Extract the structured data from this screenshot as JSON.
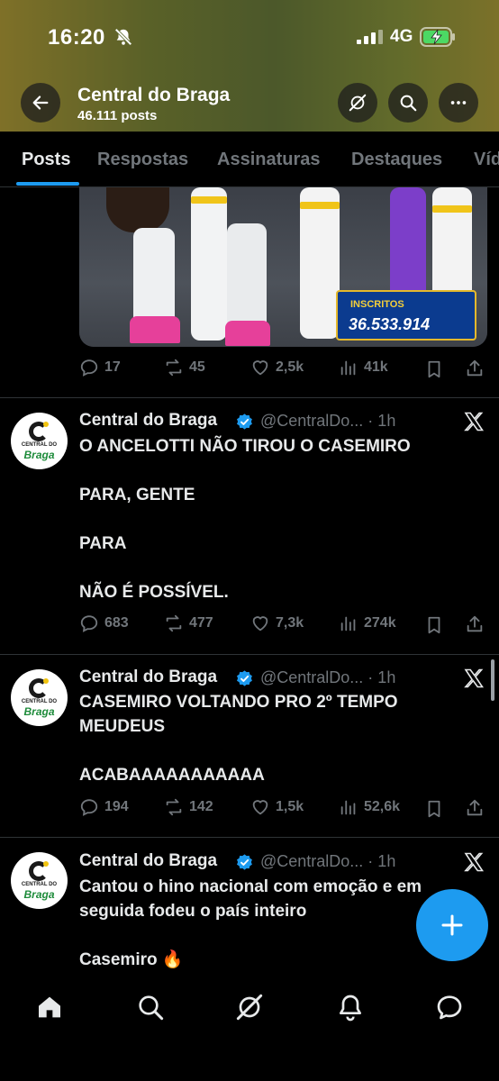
{
  "status_bar": {
    "time": "16:20",
    "network": "4G"
  },
  "profile": {
    "name": "Central do Braga",
    "post_count": "46.111 posts"
  },
  "tabs": [
    {
      "label": "Posts",
      "active": true
    },
    {
      "label": "Respostas"
    },
    {
      "label": "Assinaturas"
    },
    {
      "label": "Destaques"
    },
    {
      "label": "Víd"
    }
  ],
  "media_overlay": {
    "label": "INSCRITOS",
    "value": "36.533.914"
  },
  "avatar_text": {
    "small": "CENTRAL DO",
    "brand": "Braga"
  },
  "first_post_stats": {
    "replies": "17",
    "reposts": "45",
    "likes": "2,5k",
    "views": "41k"
  },
  "posts": [
    {
      "name": "Central do Braga",
      "handle_time": "@CentralDo... · 1h",
      "lines": [
        "O ANCELOTTI NÃO TIROU O CASEMIRO",
        "",
        "PARA, GENTE",
        "",
        "PARA",
        "",
        "NÃO É POSSÍVEL."
      ],
      "replies": "683",
      "reposts": "477",
      "likes": "7,3k",
      "views": "274k"
    },
    {
      "name": "Central do Braga",
      "handle_time": "@CentralDo... · 1h",
      "lines": [
        "CASEMIRO VOLTANDO PRO 2º TEMPO",
        "MEUDEUS",
        "",
        "ACABAAAAAAAAAAA"
      ],
      "replies": "194",
      "reposts": "142",
      "likes": "1,5k",
      "views": "52,6k"
    },
    {
      "name": "Central do Braga",
      "handle_time": "@CentralDo... · 1h",
      "lines": [
        "Cantou o hino nacional com emoção e em",
        "seguida fodeu o país inteiro",
        "",
        "Casemiro 🔥"
      ]
    }
  ],
  "colors": {
    "accent": "#1d9bf0",
    "text": "#e7e9ea",
    "muted": "#71767b",
    "divider": "#2f3336"
  },
  "icons": {
    "nav": [
      "home-icon",
      "search-icon",
      "grok-icon",
      "notifications-icon",
      "messages-icon"
    ]
  }
}
